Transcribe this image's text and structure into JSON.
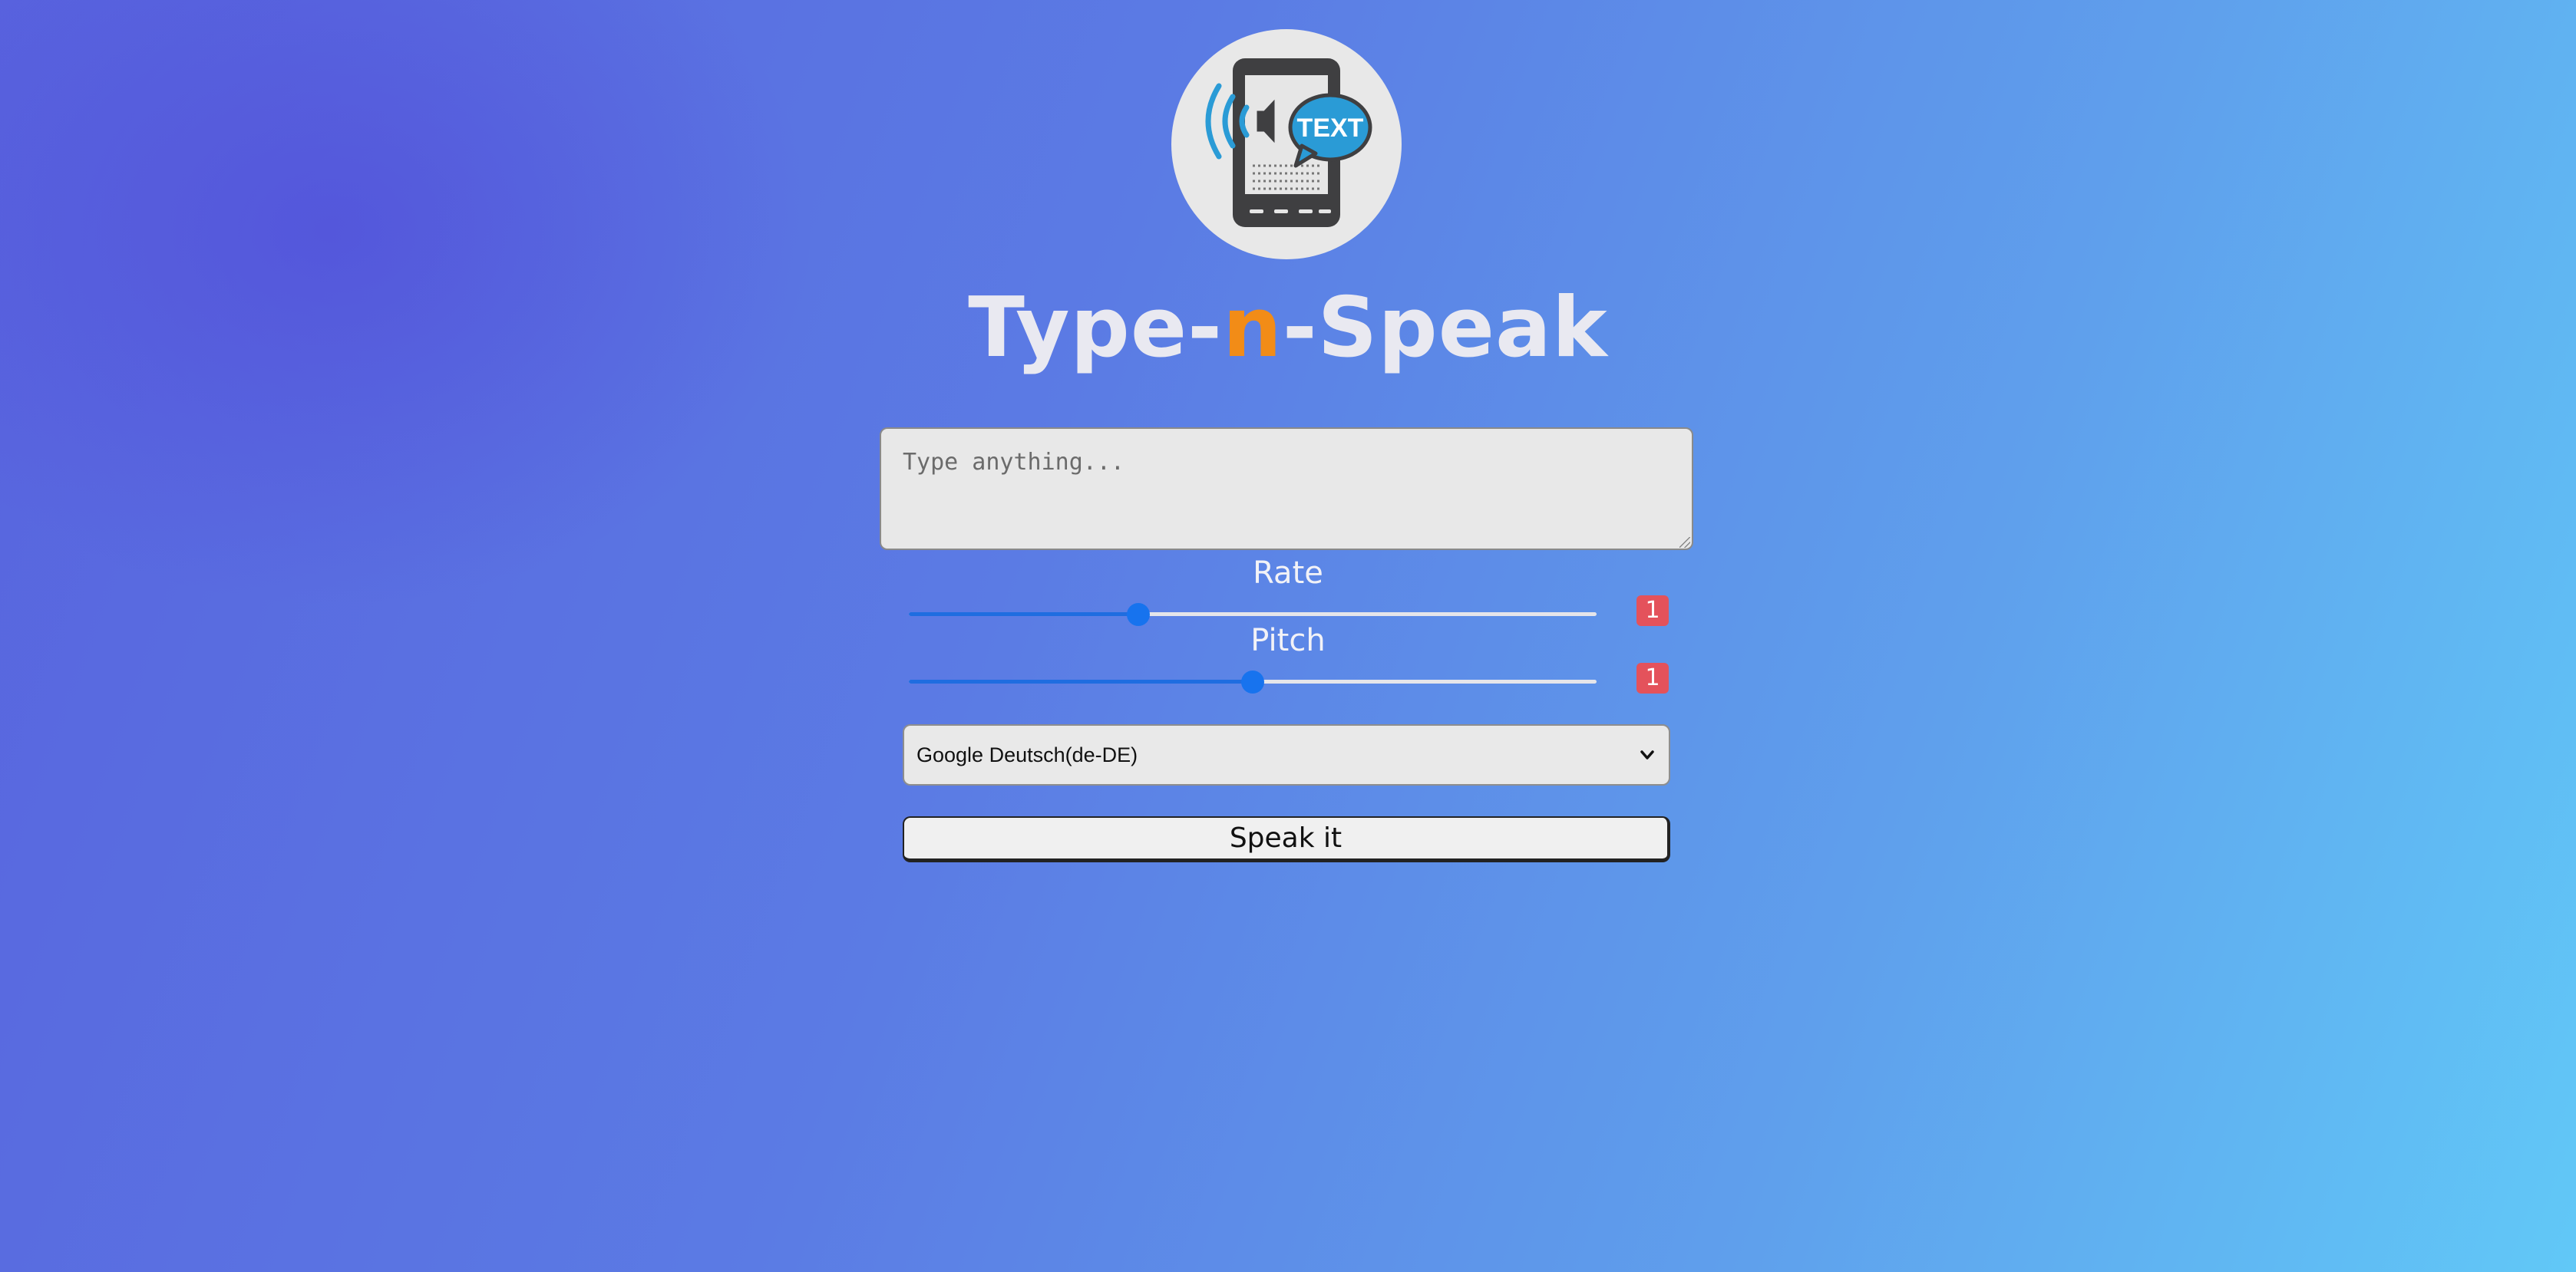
{
  "app": {
    "title_prefix": "Type-",
    "title_accent": "n",
    "title_suffix": "-Speak",
    "logo_text": "TEXT",
    "accent_color": "#f28c17"
  },
  "input": {
    "value": "",
    "placeholder": "Type anything..."
  },
  "rate": {
    "label": "Rate",
    "value": "1",
    "min": 0.5,
    "max": 2,
    "current": 1
  },
  "pitch": {
    "label": "Pitch",
    "value": "1",
    "min": 0,
    "max": 2,
    "current": 1
  },
  "voice": {
    "selected": "Google Deutsch(de-DE)"
  },
  "actions": {
    "speak_label": "Speak it"
  },
  "icons": {
    "logo": "phone-speaker-text-icon",
    "dropdown": "chevron-down-icon"
  },
  "colors": {
    "badge": "#e4525b",
    "slider": "#1773ee"
  }
}
